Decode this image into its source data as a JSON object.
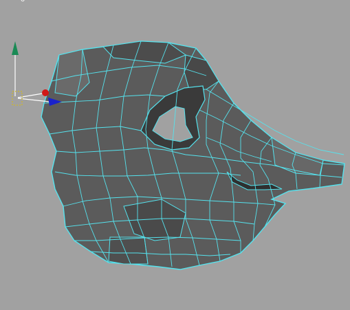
{
  "viewport": {
    "background": "#a1a1a1",
    "corner_label": "o"
  },
  "mesh": {
    "fill_dark": "#4e4e4e",
    "fill_mid": "#5d5d5d",
    "fill_light": "#6a6a6a",
    "wire_color": "#55e3ee"
  },
  "gizmo": {
    "y_axis_color": "#1a8a55",
    "x_axis_color": "#1a22cc",
    "z_axis_color": "#d01818",
    "pivot_color": "#c8b43c",
    "icons": [
      "move-gizmo-icon",
      "pivot-handle-icon"
    ]
  }
}
